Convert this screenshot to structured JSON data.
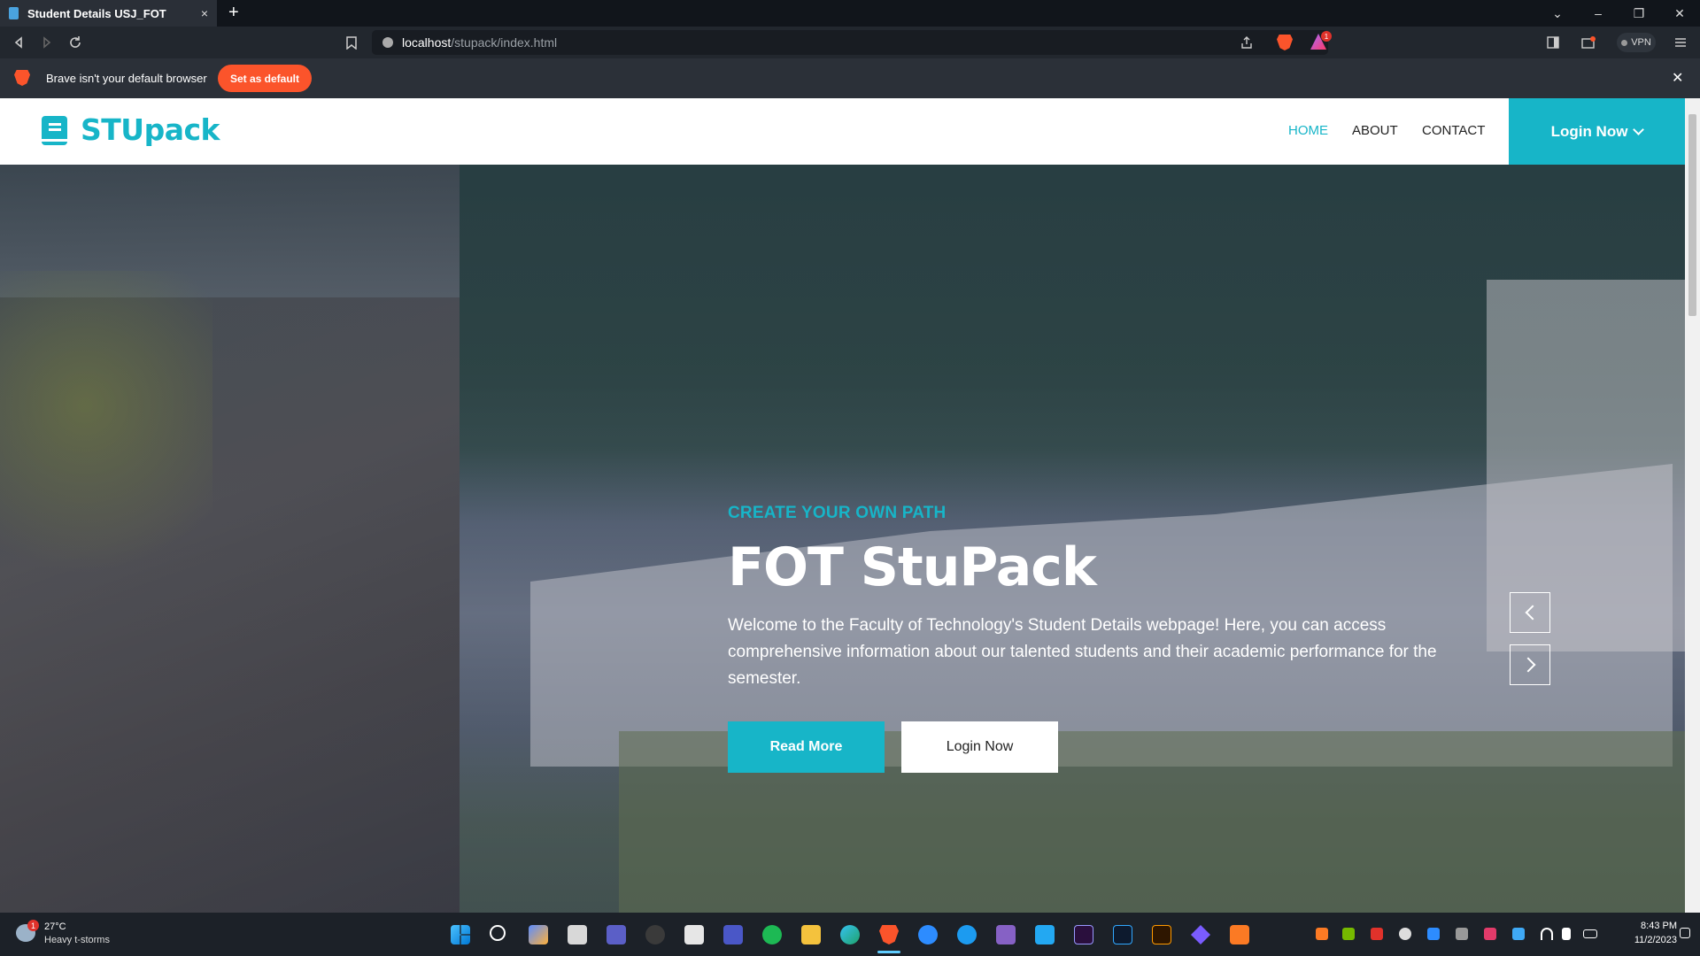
{
  "browser": {
    "tab_title": "Student Details USJ_FOT",
    "tab_close": "×",
    "new_tab": "+",
    "window_controls": {
      "minimize": "–",
      "restore": "❐",
      "close": "✕",
      "chevron": "⌄"
    },
    "url_host": "localhost",
    "url_path": "/stupack/index.html",
    "vpn_label": "VPN",
    "infobar_text": "Brave isn't your default browser",
    "set_default_label": "Set as default",
    "infobar_close": "✕",
    "notification_count": "1",
    "colors": {
      "accent": "#fb542b"
    }
  },
  "site": {
    "brand": "STUpack",
    "nav": [
      {
        "label": "HOME",
        "active": true
      },
      {
        "label": "ABOUT",
        "active": false
      },
      {
        "label": "CONTACT",
        "active": false
      }
    ],
    "login_dropdown_label": "Login Now",
    "colors": {
      "primary": "#17b5c8"
    }
  },
  "hero": {
    "kicker": "CREATE YOUR OWN PATH",
    "title": "FOT StuPack",
    "description": "Welcome to the Faculty of Technology's Student Details webpage! Here, you can access comprehensive information about our talented students and their academic performance for the semester.",
    "primary_button": "Read More",
    "secondary_button": "Login Now",
    "prev_icon": "chevron-left-icon",
    "next_icon": "chevron-right-icon"
  },
  "taskbar": {
    "weather_temp": "27°C",
    "weather_desc": "Heavy t-storms",
    "weather_badge": "1",
    "time": "8:43 PM",
    "date": "11/2/2023",
    "apps": [
      "windows-start-icon",
      "search-icon",
      "meet-icon",
      "file-view-icon",
      "teams-icon",
      "obs-icon",
      "store-icon",
      "sticky-notes-icon",
      "spotify-icon",
      "file-explorer-icon",
      "edge-icon",
      "brave-icon",
      "zoom-icon",
      "app-store-icon",
      "visual-studio-icon",
      "vscode-icon",
      "premiere-icon",
      "photoshop-icon",
      "illustrator-icon",
      "media-icon",
      "xampp-icon"
    ]
  }
}
